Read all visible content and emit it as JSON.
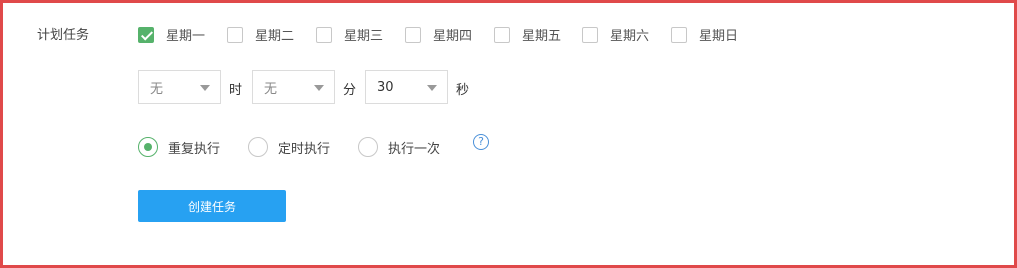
{
  "form": {
    "label": "计划任务",
    "days": [
      {
        "label": "星期一",
        "checked": true
      },
      {
        "label": "星期二",
        "checked": false
      },
      {
        "label": "星期三",
        "checked": false
      },
      {
        "label": "星期四",
        "checked": false
      },
      {
        "label": "星期五",
        "checked": false
      },
      {
        "label": "星期六",
        "checked": false
      },
      {
        "label": "星期日",
        "checked": false
      }
    ],
    "time": {
      "hour_value": "无",
      "hour_unit": "时",
      "minute_value": "无",
      "minute_unit": "分",
      "second_value": "30",
      "second_unit": "秒"
    },
    "modes": [
      {
        "label": "重复执行",
        "checked": true
      },
      {
        "label": "定时执行",
        "checked": false
      },
      {
        "label": "执行一次",
        "checked": false
      }
    ],
    "help_glyph": "?",
    "create_button": "创建任务"
  },
  "colors": {
    "accent_green": "#56b26b",
    "primary_blue": "#27a1f2",
    "frame_red": "#e0494a",
    "help_blue": "#4a90d9"
  }
}
